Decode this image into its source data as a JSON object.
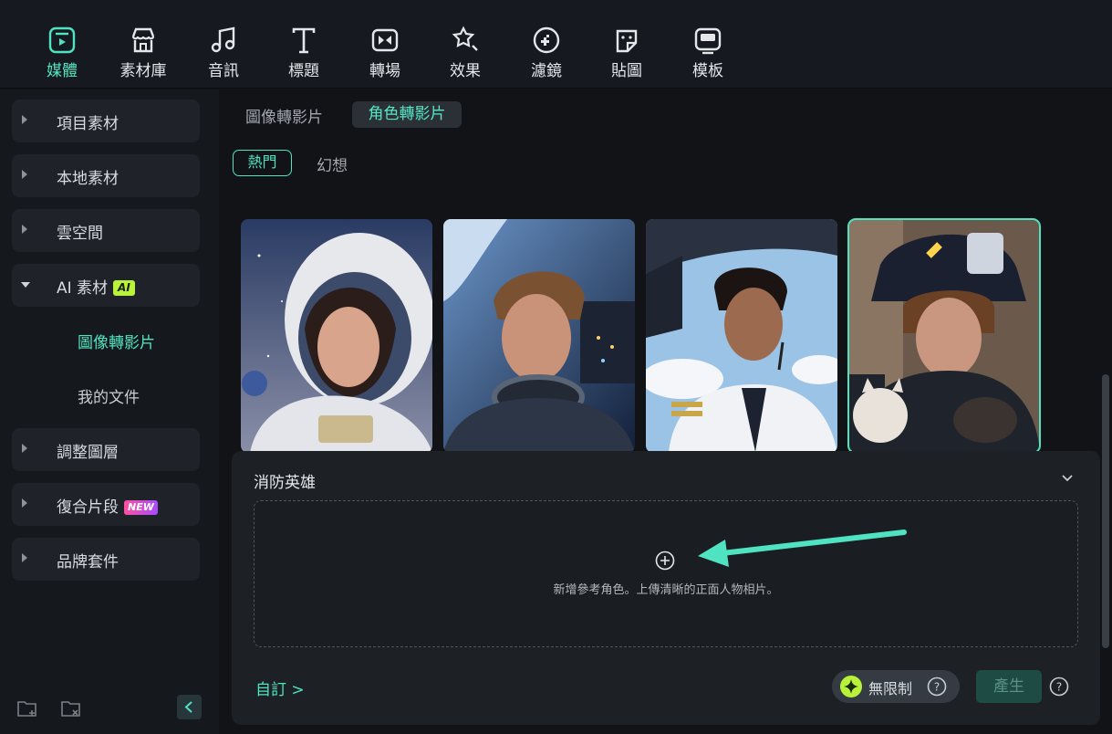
{
  "toolbar": {
    "items": [
      {
        "label": "媒體",
        "icon": "media-icon"
      },
      {
        "label": "素材庫",
        "icon": "store-icon"
      },
      {
        "label": "音訊",
        "icon": "music-note-icon"
      },
      {
        "label": "標題",
        "icon": "text-icon"
      },
      {
        "label": "轉場",
        "icon": "transition-icon"
      },
      {
        "label": "效果",
        "icon": "effects-icon"
      },
      {
        "label": "濾鏡",
        "icon": "filter-icon"
      },
      {
        "label": "貼圖",
        "icon": "sticker-icon"
      },
      {
        "label": "模板",
        "icon": "template-icon"
      }
    ],
    "active_index": 0,
    "accent": "#4fe3c1"
  },
  "sidebar": {
    "items": [
      {
        "label": "項目素材"
      },
      {
        "label": "本地素材"
      },
      {
        "label": "雲空間"
      },
      {
        "label": "AI 素材",
        "badge": "AI"
      },
      {
        "label": "調整圖層"
      },
      {
        "label": "復合片段",
        "badge": "NEW"
      },
      {
        "label": "品牌套件"
      }
    ],
    "subitems": [
      {
        "label": "圖像轉影片",
        "active": true
      },
      {
        "label": "我的文件",
        "active": false
      }
    ],
    "bottom_icons": [
      "new-folder-icon",
      "delete-folder-icon",
      "collapse-left-icon"
    ]
  },
  "main": {
    "tabs": [
      {
        "label": "圖像轉影片",
        "active": false
      },
      {
        "label": "角色轉影片",
        "active": true
      }
    ],
    "chips": [
      {
        "label": "熱門",
        "active": true
      },
      {
        "label": "幻想",
        "active": false
      }
    ],
    "cards": [
      {
        "name": "astronaut-woman",
        "selected": false
      },
      {
        "name": "astronaut-man",
        "selected": false
      },
      {
        "name": "pilot",
        "selected": false
      },
      {
        "name": "firefighter",
        "selected": true
      }
    ]
  },
  "panel": {
    "title": "消防英雄",
    "upload_hint": "新增參考角色。上傳清晰的正面人物相片。",
    "custom_link": "自訂 >",
    "unlimited_label": "無限制",
    "generate_label": "產生"
  },
  "colors": {
    "accent": "#4fe3c1",
    "ai_badge": "#b9f23a",
    "new_badge": "#ff4fa0"
  }
}
